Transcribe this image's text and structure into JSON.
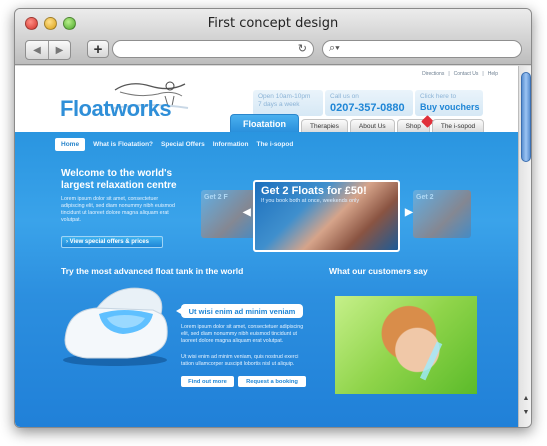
{
  "window": {
    "title": "First concept design"
  },
  "browser": {
    "back_icon": "back-arrow-icon",
    "forward_icon": "forward-arrow-icon",
    "add_tab_label": "+"
  },
  "site": {
    "toplinks": [
      "Directions",
      "Contact Us",
      "Help"
    ],
    "logo": "Floatworks",
    "info": [
      {
        "small": "Open 10am-10pm",
        "big": "7 days a week"
      },
      {
        "small": "Call us on",
        "big": "0207-357-0880"
      },
      {
        "small": "Click here to",
        "big": "Buy vouchers"
      }
    ],
    "tabs": [
      "Floatation",
      "Therapies",
      "About Us",
      "Shop",
      "The i-sopod"
    ],
    "subnav": [
      "Home",
      "What is Floatation?",
      "Special Offers",
      "Information",
      "The i-sopod"
    ],
    "welcome": "Welcome to the world's largest relaxation centre",
    "welcome_lorem": "Lorem ipsum dolor sit amet, consectetuer adipiscing elit, sed diam nonummy nibh euismod tincidunt ut laoreet dolore magna aliquam erat volutpat.",
    "offers_button": "› View special offers & prices",
    "slider": {
      "title": "Get 2 Floats for £50!",
      "subtitle": "If you book both at once, weekends only",
      "side_left": "Get 2 F",
      "side_right": "Get 2"
    },
    "float_heading": "Try the most advanced float tank in the world",
    "callout": "Ut wisi enim ad minim veniam",
    "float_lorem1": "Lorem ipsum dolor sit amet, consectetuer adipiscing elit, sed diam nonummy nibh euismod tincidunt ut laoreet dolore magna aliquam erat volutpat.",
    "float_lorem2": "Ut wisi enim ad minim veniam, quis nostrud exerci tation ullamcorper suscipit lobortis nisl ut aliquip.",
    "find_out_button": "Find out more",
    "booking_button": "Request a booking",
    "customers_heading": "What our customers say"
  },
  "colors": {
    "accent": "#2a95e0",
    "brand": "#2f8fd8"
  }
}
